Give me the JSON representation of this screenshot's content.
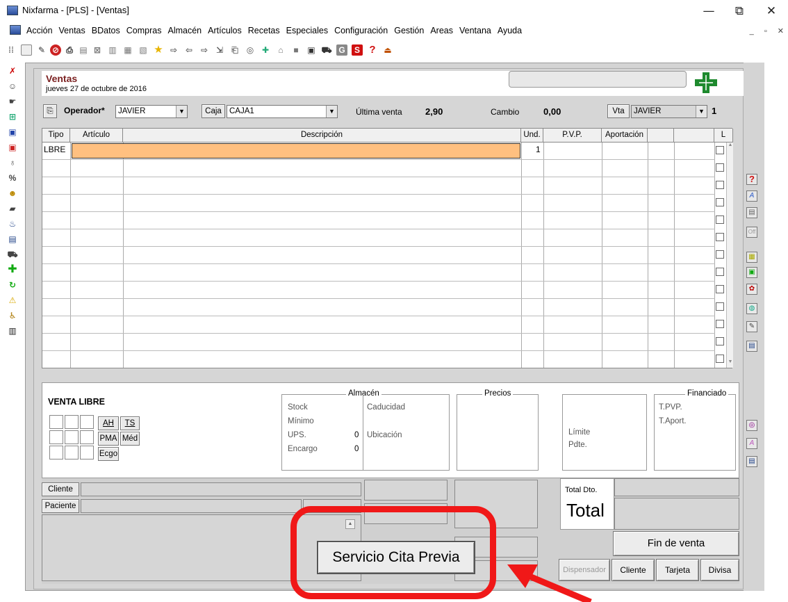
{
  "window": {
    "title": "Nixfarma - [PLS] - [Ventas]",
    "minimize": "—",
    "restore": "⧉",
    "close": "✕"
  },
  "menu": {
    "items": [
      "Acción",
      "Ventas",
      "BDatos",
      "Compras",
      "Almacén",
      "Artículos",
      "Recetas",
      "Especiales",
      "Configuración",
      "Gestión",
      "Areas",
      "Ventana",
      "Ayuda"
    ],
    "mdi_controls": "_ ▫ ✕"
  },
  "toolbar_icons": [
    "bars-icon",
    "doc-icon",
    "edit-icon",
    "stop-icon",
    "printer-icon",
    "check-doc-icon",
    "close-doc-icon",
    "doc2-icon",
    "doc3-icon",
    "doc4-icon",
    "star-icon",
    "forward-doc-icon",
    "arrow-left-icon",
    "arrow-right-icon",
    "import-icon",
    "print2-icon",
    "search-icon",
    "tools-icon",
    "home-icon",
    "square-icon",
    "clipboard-icon",
    "cart-icon",
    "g-icon",
    "s-icon",
    "help-icon",
    "upload-icon"
  ],
  "sales": {
    "title": "Ventas",
    "date": "jueves 27 de octubre de 2016",
    "operador_label": "Operador*",
    "operador_value": "JAVIER",
    "caja_label": "Caja",
    "caja_value": "CAJA1",
    "ultima_venta_label": "Última venta",
    "ultima_venta_value": "2,90",
    "cambio_label": "Cambio",
    "cambio_value": "0,00",
    "vta_label": "Vta",
    "vta_value": "JAVIER",
    "vta_count": "1"
  },
  "grid": {
    "headers": {
      "tipo": "Tipo",
      "articulo": "Artículo",
      "descripcion": "Descripción",
      "und": "Und.",
      "pvp": "P.V.P.",
      "aportacion": "Aportación",
      "l": "L"
    },
    "row1_tipo": "LBRE",
    "row1_und": "1"
  },
  "bottom": {
    "venta_libre": "VENTA LIBRE",
    "btn_ah": "AH",
    "btn_ts": "TS",
    "btn_pma": "PMA",
    "btn_med": "Méd",
    "btn_ecgo": "Ecgo",
    "almacen_title": "Almacén",
    "stock": "Stock",
    "minimo": "Mínimo",
    "ups": "UPS.",
    "ups_value": "0",
    "encargo": "Encargo",
    "encargo_value": "0",
    "caducidad": "Caducidad",
    "ubicacion": "Ubicación",
    "precios_title": "Precios",
    "limite": "Límite",
    "pdte": "Pdte.",
    "financiado_title": "Financiado",
    "tpvp": "T.PVP.",
    "taport": "T.Aport."
  },
  "footer": {
    "cliente": "Cliente",
    "paciente": "Paciente",
    "total_dto": "Total Dto.",
    "total": "Total",
    "fin_de_venta": "Fin de venta",
    "servicio_cita": "Servicio Cita Previa",
    "dispensador": "Dispensador",
    "cliente_btn": "Cliente",
    "tarjeta": "Tarjeta",
    "divisa": "Divisa"
  },
  "colors": {
    "accent_red": "#f01818",
    "title_red": "#7a1f1f",
    "selected_cell": "#ffc080",
    "pharmacy_green": "#1e8a2e"
  }
}
